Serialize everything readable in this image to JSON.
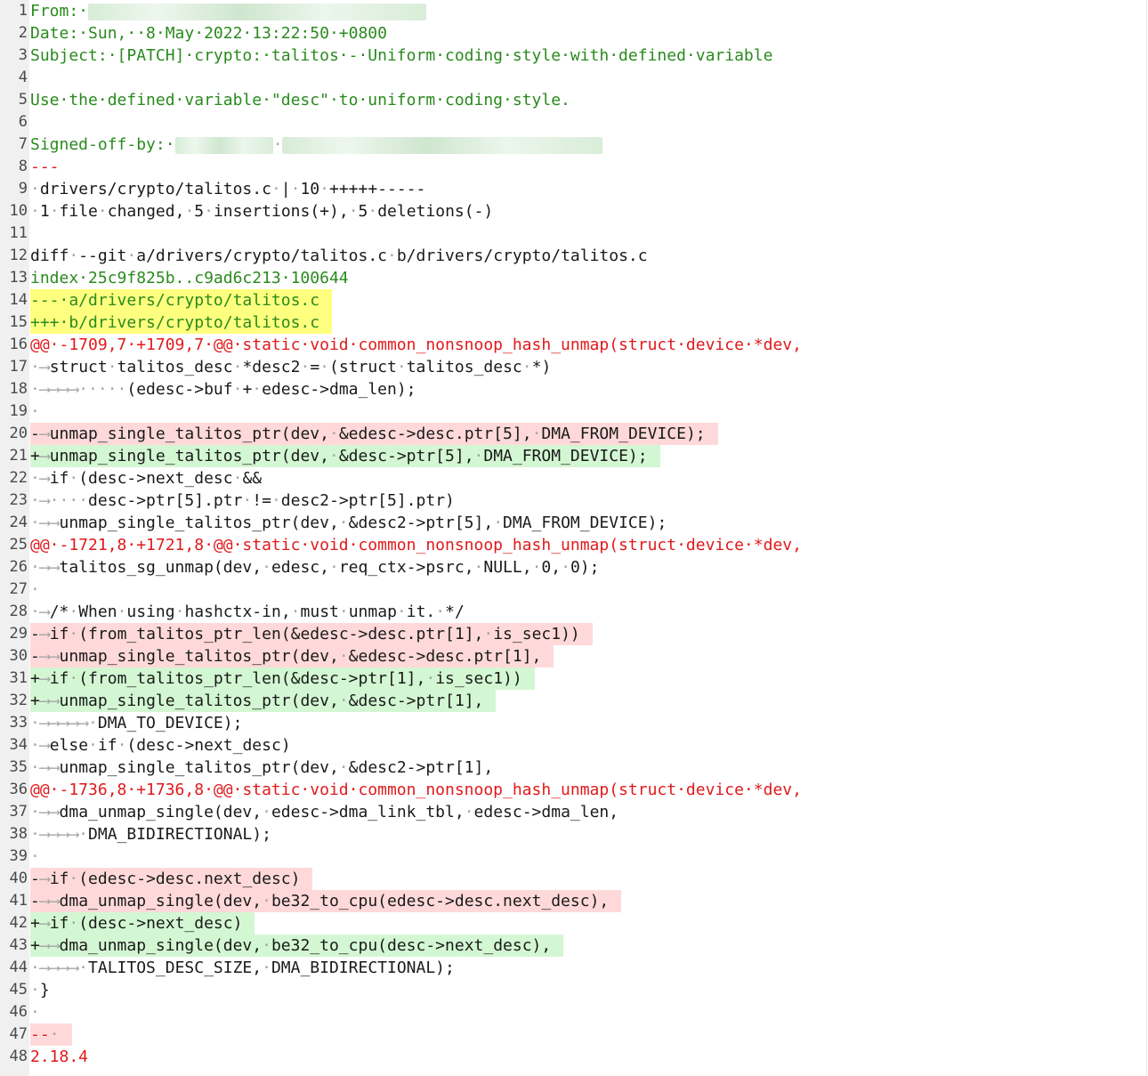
{
  "colors": {
    "meta": "#2a8a1e",
    "plain": "#1a1a1a",
    "hunk": "#e0191b",
    "whitespace": "#a5a5a5",
    "line_number": "#4a4a4a",
    "removed_bg": "#ffd9d9",
    "added_bg": "#d3f7d3",
    "file_header_bg": "#ffff7f",
    "gutter_bg": "#f0f0f0"
  },
  "lines": [
    {
      "n": "1",
      "segs": [
        {
          "t": "From:·",
          "c": "meta"
        },
        {
          "blur": true,
          "w": 380
        }
      ]
    },
    {
      "n": "2",
      "segs": [
        {
          "t": "Date:·Sun,··8·May·2022·13:22:50·+0800",
          "c": "meta"
        }
      ]
    },
    {
      "n": "3",
      "segs": [
        {
          "t": "Subject:·[PATCH]·crypto:·talitos·-·Uniform·coding·style·with·defined·variable",
          "c": "meta"
        }
      ]
    },
    {
      "n": "4",
      "segs": []
    },
    {
      "n": "5",
      "segs": [
        {
          "t": "Use·the·defined·variable·\"desc\"·to·uniform·coding·style.",
          "c": "meta"
        }
      ]
    },
    {
      "n": "6",
      "segs": []
    },
    {
      "n": "7",
      "segs": [
        {
          "t": "Signed-off-by:·",
          "c": "meta"
        },
        {
          "blur": true,
          "w": 110
        },
        {
          "t": "·",
          "c": "ws"
        },
        {
          "blur": true,
          "w": 360
        }
      ]
    },
    {
      "n": "8",
      "segs": [
        {
          "t": "---",
          "c": "hunk"
        }
      ]
    },
    {
      "n": "9",
      "segs": [
        {
          "t": "·",
          "c": "ws"
        },
        {
          "t": "drivers/crypto/talitos.c",
          "c": "plain"
        },
        {
          "t": "·",
          "c": "ws"
        },
        {
          "t": "|",
          "c": "plain"
        },
        {
          "t": "·",
          "c": "ws"
        },
        {
          "t": "10",
          "c": "plain"
        },
        {
          "t": "·",
          "c": "ws"
        },
        {
          "t": "+++++-----",
          "c": "plain"
        }
      ]
    },
    {
      "n": "10",
      "segs": [
        {
          "t": "·",
          "c": "ws"
        },
        {
          "t": "1",
          "c": "plain"
        },
        {
          "t": "·",
          "c": "ws"
        },
        {
          "t": "file",
          "c": "plain"
        },
        {
          "t": "·",
          "c": "ws"
        },
        {
          "t": "changed,",
          "c": "plain"
        },
        {
          "t": "·",
          "c": "ws"
        },
        {
          "t": "5",
          "c": "plain"
        },
        {
          "t": "·",
          "c": "ws"
        },
        {
          "t": "insertions(+),",
          "c": "plain"
        },
        {
          "t": "·",
          "c": "ws"
        },
        {
          "t": "5",
          "c": "plain"
        },
        {
          "t": "·",
          "c": "ws"
        },
        {
          "t": "deletions(-)",
          "c": "plain"
        }
      ]
    },
    {
      "n": "11",
      "segs": []
    },
    {
      "n": "12",
      "segs": [
        {
          "t": "diff",
          "c": "plain"
        },
        {
          "t": "·",
          "c": "ws"
        },
        {
          "t": "--git",
          "c": "plain"
        },
        {
          "t": "·",
          "c": "ws"
        },
        {
          "t": "a/drivers/crypto/talitos.c",
          "c": "plain"
        },
        {
          "t": "·",
          "c": "ws"
        },
        {
          "t": "b/drivers/crypto/talitos.c",
          "c": "plain"
        }
      ]
    },
    {
      "n": "13",
      "segs": [
        {
          "t": "index·25c9f825b..c9ad6c213·100644",
          "c": "meta"
        }
      ]
    },
    {
      "n": "14",
      "bg": "file_header_bg",
      "segs": [
        {
          "t": "---·a/drivers/crypto/talitos.c",
          "c": "meta"
        }
      ]
    },
    {
      "n": "15",
      "bg": "file_header_bg",
      "segs": [
        {
          "t": "+++·b/drivers/crypto/talitos.c",
          "c": "meta"
        }
      ]
    },
    {
      "n": "16",
      "segs": [
        {
          "t": "@@·-1709,7·+1709,7·@@·static·void·common_nonsnoop_hash_unmap(struct·device·*dev,",
          "c": "hunk"
        }
      ]
    },
    {
      "n": "17",
      "segs": [
        {
          "t": "·⟶",
          "c": "ws"
        },
        {
          "t": "struct",
          "c": "plain"
        },
        {
          "t": "·",
          "c": "ws"
        },
        {
          "t": "talitos_desc",
          "c": "plain"
        },
        {
          "t": "·",
          "c": "ws"
        },
        {
          "t": "*desc2",
          "c": "plain"
        },
        {
          "t": "·",
          "c": "ws"
        },
        {
          "t": "=",
          "c": "plain"
        },
        {
          "t": "·",
          "c": "ws"
        },
        {
          "t": "(struct",
          "c": "plain"
        },
        {
          "t": "·",
          "c": "ws"
        },
        {
          "t": "talitos_desc",
          "c": "plain"
        },
        {
          "t": "·",
          "c": "ws"
        },
        {
          "t": "*)",
          "c": "plain"
        }
      ]
    },
    {
      "n": "18",
      "segs": [
        {
          "t": "·⟶⟶⟶⟶·····",
          "c": "ws"
        },
        {
          "t": "(edesc->buf",
          "c": "plain"
        },
        {
          "t": "·",
          "c": "ws"
        },
        {
          "t": "+",
          "c": "plain"
        },
        {
          "t": "·",
          "c": "ws"
        },
        {
          "t": "edesc->dma_len);",
          "c": "plain"
        }
      ]
    },
    {
      "n": "19",
      "segs": [
        {
          "t": "·",
          "c": "ws"
        }
      ]
    },
    {
      "n": "20",
      "bg": "removed_bg",
      "segs": [
        {
          "t": "-",
          "c": "plain"
        },
        {
          "t": "⟶",
          "c": "ws"
        },
        {
          "t": "unmap_single_talitos_ptr(dev,",
          "c": "plain"
        },
        {
          "t": "·",
          "c": "ws"
        },
        {
          "t": "&edesc->desc.ptr[5],",
          "c": "plain"
        },
        {
          "t": "·",
          "c": "ws"
        },
        {
          "t": "DMA_FROM_DEVICE);",
          "c": "plain"
        }
      ]
    },
    {
      "n": "21",
      "bg": "added_bg",
      "segs": [
        {
          "t": "+",
          "c": "plain"
        },
        {
          "t": "⟶",
          "c": "ws"
        },
        {
          "t": "unmap_single_talitos_ptr(dev,",
          "c": "plain"
        },
        {
          "t": "·",
          "c": "ws"
        },
        {
          "t": "&desc->ptr[5],",
          "c": "plain"
        },
        {
          "t": "·",
          "c": "ws"
        },
        {
          "t": "DMA_FROM_DEVICE);",
          "c": "plain"
        }
      ]
    },
    {
      "n": "22",
      "segs": [
        {
          "t": "·⟶",
          "c": "ws"
        },
        {
          "t": "if",
          "c": "plain"
        },
        {
          "t": "·",
          "c": "ws"
        },
        {
          "t": "(desc->next_desc",
          "c": "plain"
        },
        {
          "t": "·",
          "c": "ws"
        },
        {
          "t": "&&",
          "c": "plain"
        }
      ]
    },
    {
      "n": "23",
      "segs": [
        {
          "t": "·⟶····",
          "c": "ws"
        },
        {
          "t": "desc->ptr[5].ptr",
          "c": "plain"
        },
        {
          "t": "·",
          "c": "ws"
        },
        {
          "t": "!=",
          "c": "plain"
        },
        {
          "t": "·",
          "c": "ws"
        },
        {
          "t": "desc2->ptr[5].ptr)",
          "c": "plain"
        }
      ]
    },
    {
      "n": "24",
      "segs": [
        {
          "t": "·⟶⟶",
          "c": "ws"
        },
        {
          "t": "unmap_single_talitos_ptr(dev,",
          "c": "plain"
        },
        {
          "t": "·",
          "c": "ws"
        },
        {
          "t": "&desc2->ptr[5],",
          "c": "plain"
        },
        {
          "t": "·",
          "c": "ws"
        },
        {
          "t": "DMA_FROM_DEVICE);",
          "c": "plain"
        }
      ]
    },
    {
      "n": "25",
      "segs": [
        {
          "t": "@@·-1721,8·+1721,8·@@·static·void·common_nonsnoop_hash_unmap(struct·device·*dev,",
          "c": "hunk"
        }
      ]
    },
    {
      "n": "26",
      "segs": [
        {
          "t": "·⟶⟶",
          "c": "ws"
        },
        {
          "t": "talitos_sg_unmap(dev,",
          "c": "plain"
        },
        {
          "t": "·",
          "c": "ws"
        },
        {
          "t": "edesc,",
          "c": "plain"
        },
        {
          "t": "·",
          "c": "ws"
        },
        {
          "t": "req_ctx->psrc,",
          "c": "plain"
        },
        {
          "t": "·",
          "c": "ws"
        },
        {
          "t": "NULL,",
          "c": "plain"
        },
        {
          "t": "·",
          "c": "ws"
        },
        {
          "t": "0,",
          "c": "plain"
        },
        {
          "t": "·",
          "c": "ws"
        },
        {
          "t": "0);",
          "c": "plain"
        }
      ]
    },
    {
      "n": "27",
      "segs": [
        {
          "t": "·",
          "c": "ws"
        }
      ]
    },
    {
      "n": "28",
      "segs": [
        {
          "t": "·⟶",
          "c": "ws"
        },
        {
          "t": "/*",
          "c": "plain"
        },
        {
          "t": "·",
          "c": "ws"
        },
        {
          "t": "When",
          "c": "plain"
        },
        {
          "t": "·",
          "c": "ws"
        },
        {
          "t": "using",
          "c": "plain"
        },
        {
          "t": "·",
          "c": "ws"
        },
        {
          "t": "hashctx-in,",
          "c": "plain"
        },
        {
          "t": "·",
          "c": "ws"
        },
        {
          "t": "must",
          "c": "plain"
        },
        {
          "t": "·",
          "c": "ws"
        },
        {
          "t": "unmap",
          "c": "plain"
        },
        {
          "t": "·",
          "c": "ws"
        },
        {
          "t": "it.",
          "c": "plain"
        },
        {
          "t": "·",
          "c": "ws"
        },
        {
          "t": "*/",
          "c": "plain"
        }
      ]
    },
    {
      "n": "29",
      "bg": "removed_bg",
      "segs": [
        {
          "t": "-",
          "c": "plain"
        },
        {
          "t": "⟶",
          "c": "ws"
        },
        {
          "t": "if",
          "c": "plain"
        },
        {
          "t": "·",
          "c": "ws"
        },
        {
          "t": "(from_talitos_ptr_len(&edesc->desc.ptr[1],",
          "c": "plain"
        },
        {
          "t": "·",
          "c": "ws"
        },
        {
          "t": "is_sec1))",
          "c": "plain"
        }
      ]
    },
    {
      "n": "30",
      "bg": "removed_bg",
      "segs": [
        {
          "t": "-",
          "c": "plain"
        },
        {
          "t": "⟶⟶",
          "c": "ws"
        },
        {
          "t": "unmap_single_talitos_ptr(dev,",
          "c": "plain"
        },
        {
          "t": "·",
          "c": "ws"
        },
        {
          "t": "&edesc->desc.ptr[1],",
          "c": "plain"
        }
      ]
    },
    {
      "n": "31",
      "bg": "added_bg",
      "segs": [
        {
          "t": "+",
          "c": "plain"
        },
        {
          "t": "⟶",
          "c": "ws"
        },
        {
          "t": "if",
          "c": "plain"
        },
        {
          "t": "·",
          "c": "ws"
        },
        {
          "t": "(from_talitos_ptr_len(&desc->ptr[1],",
          "c": "plain"
        },
        {
          "t": "·",
          "c": "ws"
        },
        {
          "t": "is_sec1))",
          "c": "plain"
        }
      ]
    },
    {
      "n": "32",
      "bg": "added_bg",
      "segs": [
        {
          "t": "+",
          "c": "plain"
        },
        {
          "t": "⟶⟶",
          "c": "ws"
        },
        {
          "t": "unmap_single_talitos_ptr(dev,",
          "c": "plain"
        },
        {
          "t": "·",
          "c": "ws"
        },
        {
          "t": "&desc->ptr[1],",
          "c": "plain"
        }
      ]
    },
    {
      "n": "33",
      "segs": [
        {
          "t": "·⟶⟶⟶⟶⟶·",
          "c": "ws"
        },
        {
          "t": "DMA_TO_DEVICE);",
          "c": "plain"
        }
      ]
    },
    {
      "n": "34",
      "segs": [
        {
          "t": "·⟶",
          "c": "ws"
        },
        {
          "t": "else",
          "c": "plain"
        },
        {
          "t": "·",
          "c": "ws"
        },
        {
          "t": "if",
          "c": "plain"
        },
        {
          "t": "·",
          "c": "ws"
        },
        {
          "t": "(desc->next_desc)",
          "c": "plain"
        }
      ]
    },
    {
      "n": "35",
      "segs": [
        {
          "t": "·⟶⟶",
          "c": "ws"
        },
        {
          "t": "unmap_single_talitos_ptr(dev,",
          "c": "plain"
        },
        {
          "t": "·",
          "c": "ws"
        },
        {
          "t": "&desc2->ptr[1],",
          "c": "plain"
        }
      ]
    },
    {
      "n": "36",
      "segs": [
        {
          "t": "@@·-1736,8·+1736,8·@@·static·void·common_nonsnoop_hash_unmap(struct·device·*dev,",
          "c": "hunk"
        }
      ]
    },
    {
      "n": "37",
      "segs": [
        {
          "t": "·⟶⟶",
          "c": "ws"
        },
        {
          "t": "dma_unmap_single(dev,",
          "c": "plain"
        },
        {
          "t": "·",
          "c": "ws"
        },
        {
          "t": "edesc->dma_link_tbl,",
          "c": "plain"
        },
        {
          "t": "·",
          "c": "ws"
        },
        {
          "t": "edesc->dma_len,",
          "c": "plain"
        }
      ]
    },
    {
      "n": "38",
      "segs": [
        {
          "t": "·⟶⟶⟶⟶·",
          "c": "ws"
        },
        {
          "t": "DMA_BIDIRECTIONAL);",
          "c": "plain"
        }
      ]
    },
    {
      "n": "39",
      "segs": [
        {
          "t": "·",
          "c": "ws"
        }
      ]
    },
    {
      "n": "40",
      "bg": "removed_bg",
      "segs": [
        {
          "t": "-",
          "c": "plain"
        },
        {
          "t": "⟶",
          "c": "ws"
        },
        {
          "t": "if",
          "c": "plain"
        },
        {
          "t": "·",
          "c": "ws"
        },
        {
          "t": "(edesc->desc.next_desc)",
          "c": "plain"
        }
      ]
    },
    {
      "n": "41",
      "bg": "removed_bg",
      "segs": [
        {
          "t": "-",
          "c": "plain"
        },
        {
          "t": "⟶⟶",
          "c": "ws"
        },
        {
          "t": "dma_unmap_single(dev,",
          "c": "plain"
        },
        {
          "t": "·",
          "c": "ws"
        },
        {
          "t": "be32_to_cpu(edesc->desc.next_desc),",
          "c": "plain"
        }
      ]
    },
    {
      "n": "42",
      "bg": "added_bg",
      "segs": [
        {
          "t": "+",
          "c": "plain"
        },
        {
          "t": "⟶",
          "c": "ws"
        },
        {
          "t": "if",
          "c": "plain"
        },
        {
          "t": "·",
          "c": "ws"
        },
        {
          "t": "(desc->next_desc)",
          "c": "plain"
        }
      ]
    },
    {
      "n": "43",
      "bg": "added_bg",
      "segs": [
        {
          "t": "+",
          "c": "plain"
        },
        {
          "t": "⟶⟶",
          "c": "ws"
        },
        {
          "t": "dma_unmap_single(dev,",
          "c": "plain"
        },
        {
          "t": "·",
          "c": "ws"
        },
        {
          "t": "be32_to_cpu(desc->next_desc),",
          "c": "plain"
        }
      ]
    },
    {
      "n": "44",
      "segs": [
        {
          "t": "·⟶⟶⟶⟶·",
          "c": "ws"
        },
        {
          "t": "TALITOS_DESC_SIZE,",
          "c": "plain"
        },
        {
          "t": "·",
          "c": "ws"
        },
        {
          "t": "DMA_BIDIRECTIONAL);",
          "c": "plain"
        }
      ]
    },
    {
      "n": "45",
      "segs": [
        {
          "t": "·",
          "c": "ws"
        },
        {
          "t": "}",
          "c": "plain"
        }
      ]
    },
    {
      "n": "46",
      "segs": [
        {
          "t": "·",
          "c": "ws"
        }
      ]
    },
    {
      "n": "47",
      "bg": "removed_bg",
      "segs": [
        {
          "t": "--",
          "c": "hunk"
        },
        {
          "t": "·",
          "c": "ws"
        }
      ]
    },
    {
      "n": "48",
      "segs": [
        {
          "t": "2.18.4",
          "c": "hunk"
        }
      ]
    }
  ]
}
